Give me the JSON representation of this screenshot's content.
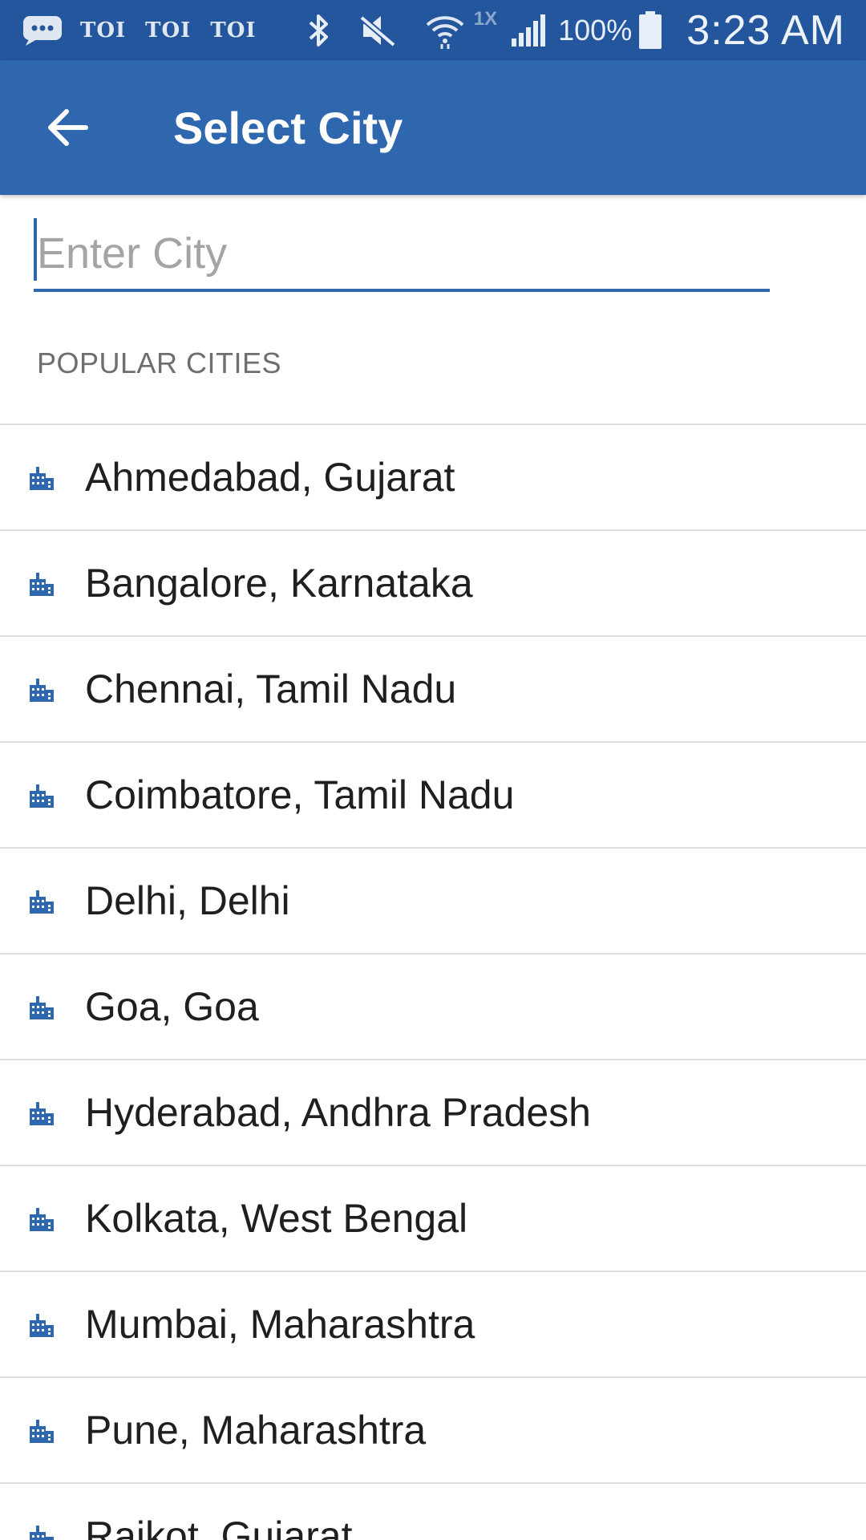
{
  "status_bar": {
    "notifications": [
      "TOI",
      "TOI",
      "TOI"
    ],
    "network_label": "1X",
    "battery": "100%",
    "time": "3:23 AM",
    "icons": [
      "message-icon",
      "bluetooth-icon",
      "mute-icon",
      "wifi-icon",
      "signal-icon",
      "battery-icon"
    ]
  },
  "toolbar": {
    "back_icon": "arrow-back-icon",
    "title": "Select City",
    "color": "#2f67ae"
  },
  "search": {
    "placeholder": "Enter City",
    "value": ""
  },
  "popular": {
    "header": "POPULAR CITIES",
    "item_icon": "city-buildings-icon",
    "icon_color": "#2f67ae",
    "cities": [
      "Ahmedabad, Gujarat",
      "Bangalore, Karnataka",
      "Chennai, Tamil Nadu",
      "Coimbatore, Tamil Nadu",
      "Delhi, Delhi",
      "Goa, Goa",
      "Hyderabad, Andhra Pradesh",
      "Kolkata, West Bengal",
      "Mumbai, Maharashtra",
      "Pune, Maharashtra",
      "Rajkot, Gujarat"
    ]
  }
}
